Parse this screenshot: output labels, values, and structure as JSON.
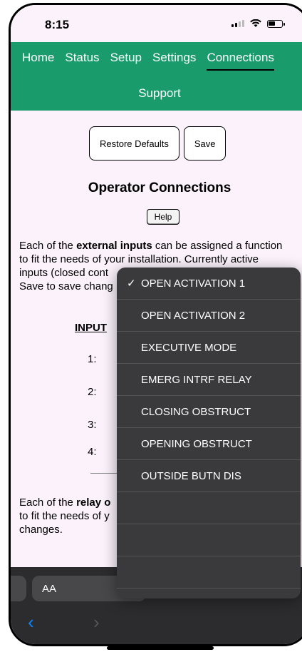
{
  "status_bar": {
    "time": "8:15"
  },
  "nav": {
    "tabs": [
      {
        "label": "Home"
      },
      {
        "label": "Status"
      },
      {
        "label": "Setup"
      },
      {
        "label": "Settings"
      },
      {
        "label": "Connections"
      }
    ],
    "active_tab": "Connections",
    "second_row": "Support"
  },
  "toolbar": {
    "restore_label": "Restore Defaults",
    "save_label": "Save"
  },
  "page": {
    "title": "Operator Connections",
    "help_label": "Help",
    "para1": {
      "line1_pre": "Each of the ",
      "line1_bold": "external inputs",
      "line1_post": " can be assigned a function",
      "line2": "to fit the needs of your installation. Currently active",
      "line3": "inputs (closed cont",
      "line4": "Save to save chang"
    },
    "input_header": "INPUT",
    "input_rows": [
      "1:",
      "2:",
      "3:",
      "4:"
    ],
    "para2": {
      "line1_pre": "Each of the ",
      "line1_bold": "relay o",
      "line2": "to fit the needs of y",
      "line3": "changes."
    }
  },
  "dropdown": {
    "selected": "OPEN ACTIVATION 1",
    "options": [
      "OPEN ACTIVATION 1",
      "OPEN ACTIVATION 2",
      "EXECUTIVE MODE",
      "EMERG INTRF RELAY",
      "CLOSING OBSTRUCT",
      "OPENING OBSTRUCT",
      "OUTSIDE BUTN DIS"
    ]
  },
  "keyboard_bar": {
    "aa_label": "AA"
  },
  "colors": {
    "nav_bg": "#1a9b6b",
    "page_bg": "#fbf2fb",
    "menu_bg": "#3a3a3c"
  }
}
